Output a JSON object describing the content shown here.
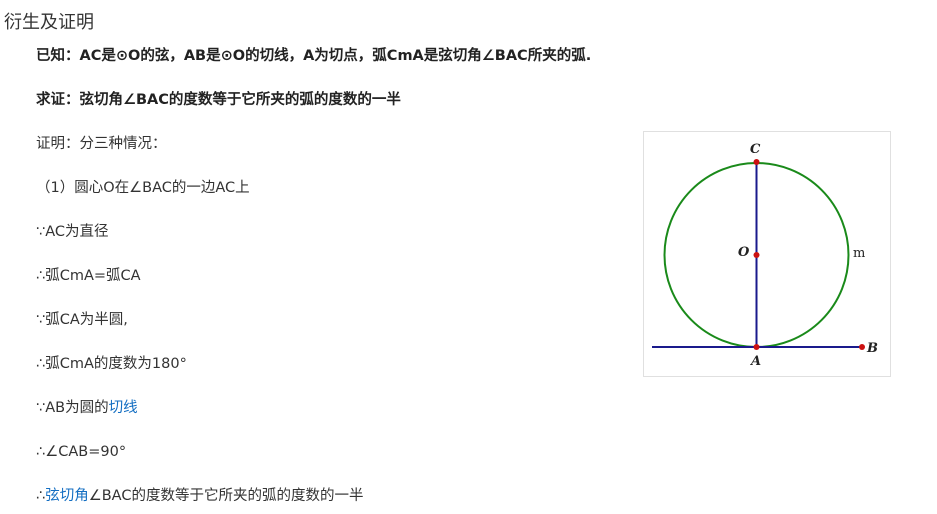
{
  "section": {
    "title": "衍生及证明"
  },
  "known": {
    "text": "已知：AC是⊙O的弦，AB是⊙O的切线，A为切点，弧CmA是弦切角∠BAC所夹的弧."
  },
  "prove": {
    "text": "求证：弦切角∠BAC的度数等于它所夹的弧的度数的一半"
  },
  "proof": {
    "intro": "证明：分三种情况：",
    "case1": "（1）圆心O在∠BAC的一边AC上",
    "l1": "∵AC为直径",
    "l2": "∴弧CmA=弧CA",
    "l3": "∵弧CA为半圆,",
    "l4": "∴弧CmA的度数为180°",
    "l5_prefix": "∵AB为圆的",
    "l5_link": "切线",
    "l6": "∴∠CAB=90°",
    "l7_prefix": "∴",
    "l7_link": "弦切角",
    "l7_suffix": "∠BAC的度数等于它所夹的弧的度数的一半"
  },
  "figure": {
    "labels": {
      "C": "C",
      "O": "O",
      "A": "A",
      "B": "B",
      "m": "m"
    },
    "colors": {
      "circle": "#1a8a1a",
      "line": "#1a1a8c",
      "point": "#cc1111"
    }
  }
}
